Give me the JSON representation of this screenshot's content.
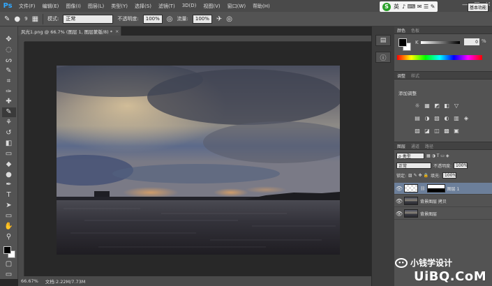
{
  "app": {
    "logo": "Ps"
  },
  "menu": [
    "文件(F)",
    "编辑(E)",
    "图像(I)",
    "图层(L)",
    "类型(Y)",
    "选择(S)",
    "滤镜(T)",
    "3D(D)",
    "视图(V)",
    "窗口(W)",
    "帮助(H)"
  ],
  "window_controls": [
    "—",
    "□",
    "✕"
  ],
  "options": {
    "brush_size": "9",
    "mode_label": "模式:",
    "mode_value": "正常",
    "opacity_label": "不透明度:",
    "opacity_value": "100%",
    "flow_label": "流量:",
    "flow_value": "100%"
  },
  "ime": {
    "logo": "S",
    "lang": "英",
    "icons": "♪ ⌨ ✉ ☰ ✎"
  },
  "workspace": "基本功能",
  "document": {
    "tab_title": "风光1.png @ 66.7% (图层 1, 图层蒙版/8) *",
    "close": "×",
    "zoom": "66.67%",
    "doc_info": "文档:2.22M/7.73M"
  },
  "tools": [
    "move-icon",
    "marquee-icon",
    "lasso-icon",
    "quick-select-icon",
    "crop-icon",
    "eyedropper-icon",
    "healing-icon",
    "brush-icon",
    "stamp-icon",
    "history-brush-icon",
    "eraser-icon",
    "gradient-icon",
    "blur-icon",
    "dodge-icon",
    "pen-icon",
    "type-icon",
    "path-select-icon",
    "shape-icon",
    "hand-icon",
    "zoom-icon"
  ],
  "tool_glyphs": [
    "✥",
    "◌",
    "ᔕ",
    "✎",
    "⌗",
    "✑",
    "✚",
    "✎",
    "⚘",
    "↺",
    "◧",
    "▭",
    "◆",
    "●",
    "✒",
    "T",
    "➤",
    "▭",
    "✋",
    "⚲"
  ],
  "color_panel": {
    "tabs": [
      "颜色",
      "色板"
    ],
    "k_label": "K",
    "k_value": "0",
    "k_unit": "%"
  },
  "adjust_panel": {
    "tabs": [
      "调整",
      "样式"
    ],
    "title": "添加调整",
    "rows": [
      [
        "☼",
        "▦",
        "◩",
        "◧",
        "▽"
      ],
      [
        "▤",
        "◑",
        "▧",
        "◐",
        "▥",
        "◈"
      ],
      [
        "▨",
        "◪",
        "◫",
        "▩",
        "▣"
      ]
    ]
  },
  "layers_panel": {
    "tabs": [
      "图层",
      "通道",
      "路径"
    ],
    "filter_label": "ρ 类型",
    "blend_mode": "正常",
    "opacity_label": "不透明度:",
    "opacity_value": "100%",
    "lock_label": "锁定:",
    "lock_icons": "▨ ✎ ✥ 🔒",
    "fill_label": "填充:",
    "fill_value": "100%",
    "layers": [
      {
        "name": "图层 1",
        "selected": true
      },
      {
        "name": "背景图层 拷贝",
        "selected": false
      },
      {
        "name": "背景图层",
        "selected": false
      }
    ]
  },
  "watermark": {
    "text": "小钱学设计",
    "site": "UiBQ.CoM"
  }
}
